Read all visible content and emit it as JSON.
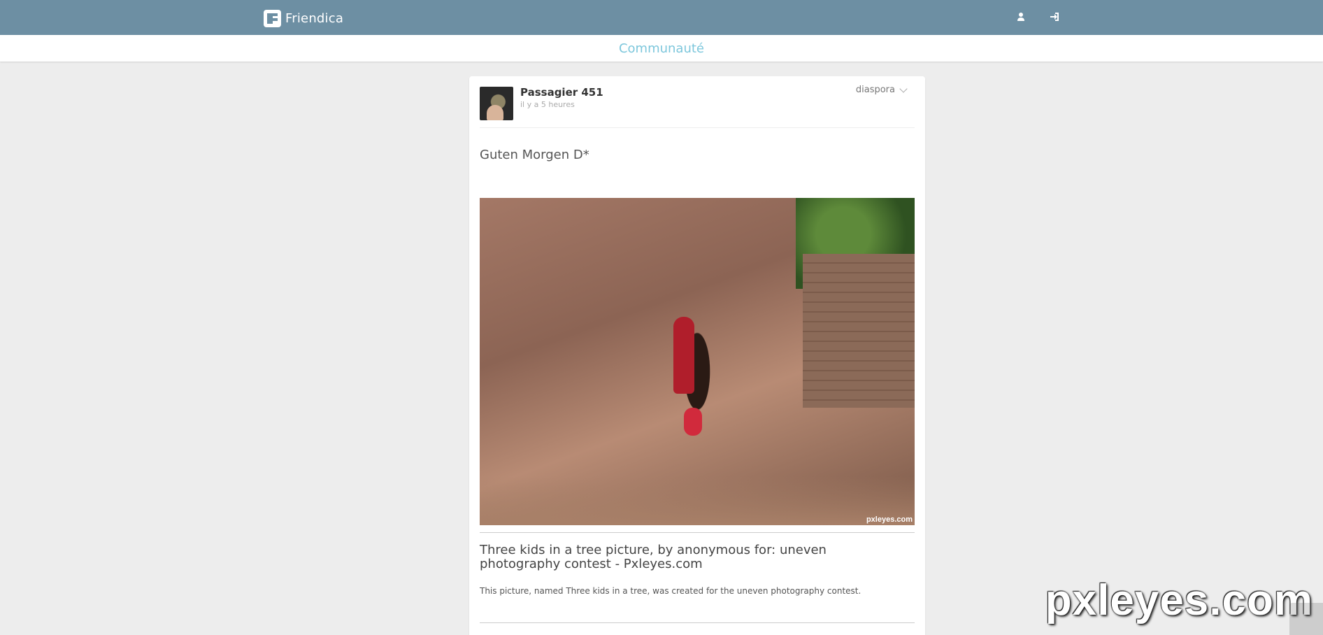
{
  "app": {
    "name": "Friendica"
  },
  "topbar": {
    "register_icon": "user-plus-icon",
    "login_icon": "sign-in-icon"
  },
  "subbar": {
    "title": "Communauté"
  },
  "post": {
    "author": "Passagier 451",
    "time": "il y a 5 heures",
    "network": "diaspora",
    "text": "Guten Morgen D*",
    "image_watermark": "pxleyes.com",
    "link_title": "Three kids in a tree picture, by anonymous for: uneven photography contest - Pxleyes.com",
    "link_description": "This picture, named Three kids in a tree, was created for the uneven photography contest."
  },
  "overlay": {
    "watermark": "pxleyes.com"
  },
  "colors": {
    "topbar": "#6d8fa3",
    "accent": "#7dc7dc",
    "background": "#ededed"
  }
}
